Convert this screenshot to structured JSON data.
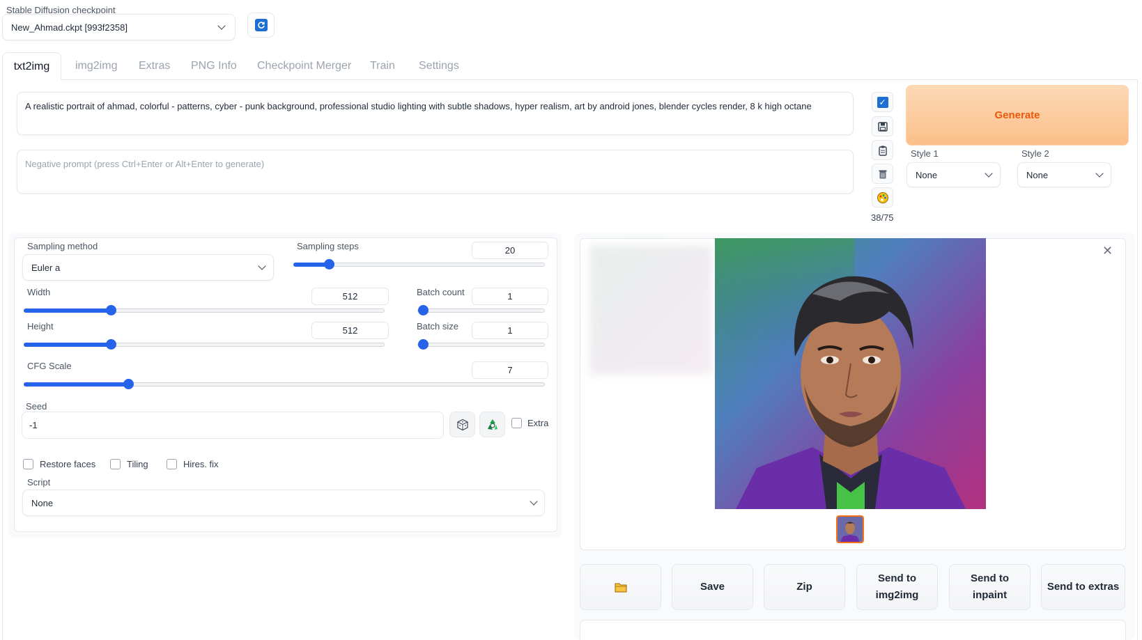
{
  "checkpoint": {
    "label": "Stable Diffusion checkpoint",
    "value": "New_Ahmad.ckpt [993f2358]"
  },
  "tabs": [
    {
      "label": "txt2img"
    },
    {
      "label": "img2img"
    },
    {
      "label": "Extras"
    },
    {
      "label": "PNG Info"
    },
    {
      "label": "Checkpoint Merger"
    },
    {
      "label": "Train"
    },
    {
      "label": "Settings"
    }
  ],
  "prompt": {
    "value": "A realistic portrait of ahmad, colorful - patterns, cyber - punk background, professional studio lighting with subtle shadows, hyper realism, art by android jones, blender cycles render, 8 k high octane",
    "negative_placeholder": "Negative prompt (press Ctrl+Enter or Alt+Enter to generate)",
    "token_count": "38/75"
  },
  "generate": {
    "label": "Generate"
  },
  "styles": {
    "style1_label": "Style 1",
    "style1_value": "None",
    "style2_label": "Style 2",
    "style2_value": "None"
  },
  "settings": {
    "sampling_method_label": "Sampling method",
    "sampling_method_value": "Euler a",
    "sampling_steps_label": "Sampling steps",
    "sampling_steps_value": "20",
    "width_label": "Width",
    "width_value": "512",
    "height_label": "Height",
    "height_value": "512",
    "batch_count_label": "Batch count",
    "batch_count_value": "1",
    "batch_size_label": "Batch size",
    "batch_size_value": "1",
    "cfg_label": "CFG Scale",
    "cfg_value": "7",
    "seed_label": "Seed",
    "seed_value": "-1",
    "extra_label": "Extra",
    "restore_faces_label": "Restore faces",
    "tiling_label": "Tiling",
    "hires_label": "Hires. fix",
    "script_label": "Script",
    "script_value": "None"
  },
  "slider_levels": {
    "sampling_steps": 0.14,
    "width": 0.24,
    "height": 0.24,
    "batch_count": 0.0,
    "batch_size": 0.0,
    "cfg": 0.2
  },
  "actions": {
    "folder_icon": "folder-icon",
    "save": "Save",
    "zip": "Zip",
    "send_img2img_1": "Send to",
    "send_img2img_2": "img2img",
    "send_inpaint_1": "Send to",
    "send_inpaint_2": "inpaint",
    "send_extras": "Send to extras"
  },
  "colors": {
    "accent": "#2563eb",
    "generate_text": "#ea580c"
  }
}
